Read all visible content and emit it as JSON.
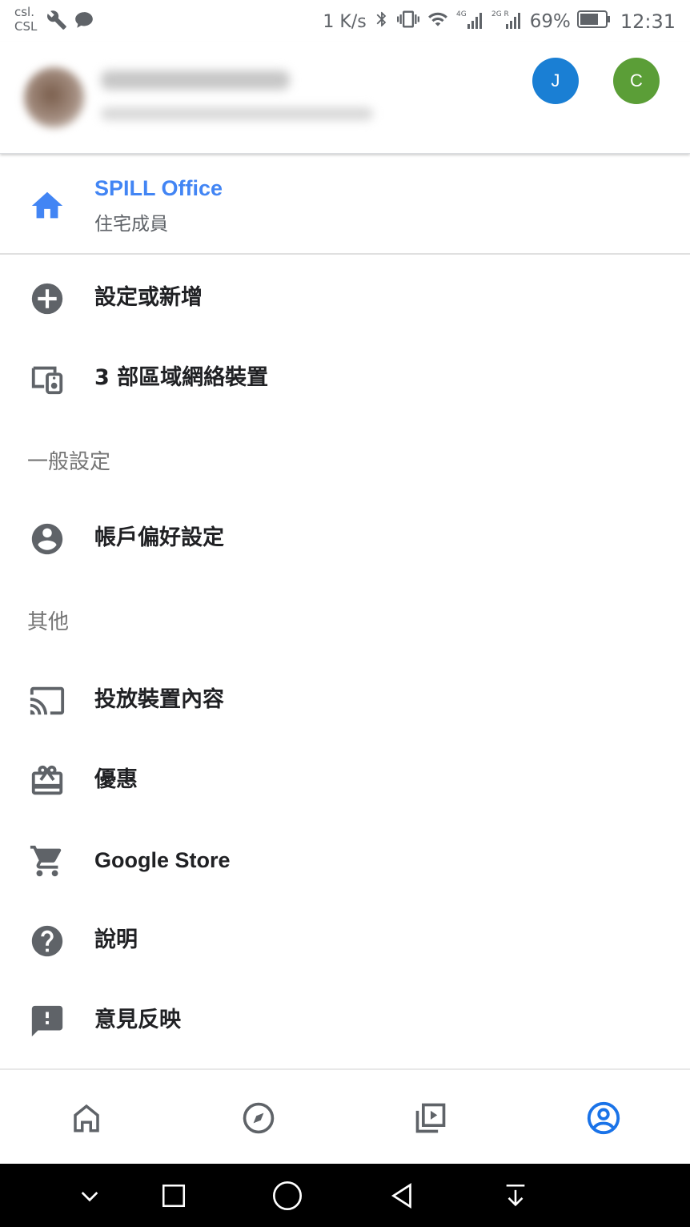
{
  "status_bar": {
    "carrier_line1": "csl.",
    "carrier_line2": "CSL",
    "net_speed": "1 K/s",
    "battery_percent": "69%",
    "time": "12:31",
    "icons": [
      "wrench-icon",
      "chat-icon",
      "bluetooth-icon",
      "vibrate-icon",
      "wifi-icon",
      "signal-4g-icon",
      "signal-2g-icon",
      "battery-icon"
    ]
  },
  "account": {
    "accounts": [
      {
        "initial": "J",
        "color": "#1a7fd4"
      },
      {
        "initial": "C",
        "color": "#5b9e37"
      }
    ]
  },
  "home": {
    "title": "SPILL Office",
    "subtitle": "住宅成員",
    "icon": "home-icon",
    "accent": "#4285f4"
  },
  "menu": {
    "setup_add": "設定或新增",
    "lan_devices": "3 部區域網絡裝置",
    "section_general": "一般設定",
    "account_prefs": "帳戶偏好設定",
    "section_other": "其他",
    "cast_content": "投放裝置內容",
    "offers": "優惠",
    "google_store": "Google Store",
    "help": "說明",
    "feedback": "意見反映"
  },
  "bottom_nav": {
    "items": [
      "home-nav-icon",
      "discover-nav-icon",
      "media-nav-icon",
      "account-nav-icon"
    ],
    "active": "account-nav-icon",
    "active_color": "#1a73e8"
  },
  "system_nav": {
    "items": [
      "collapse-icon",
      "recents-icon",
      "home-circle-icon",
      "back-icon",
      "notification-pull-icon"
    ]
  }
}
